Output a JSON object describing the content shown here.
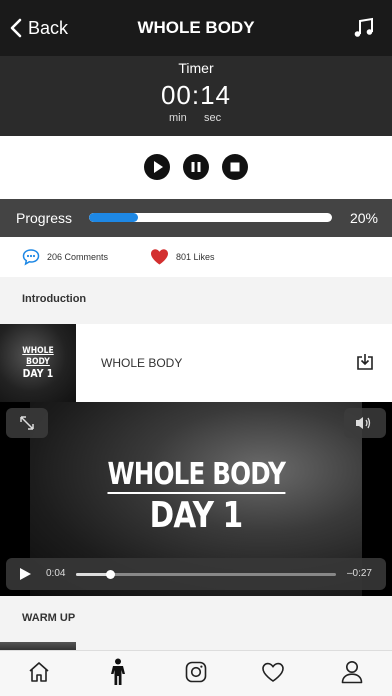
{
  "nav": {
    "back_label": "Back",
    "title": "WHOLE BODY",
    "music_icon": "music-note-icon"
  },
  "timer": {
    "label": "Timer",
    "value": "00:14",
    "min_label": "min",
    "sec_label": "sec"
  },
  "controls": {
    "play_icon": "play-icon",
    "pause_icon": "pause-icon",
    "stop_icon": "stop-icon"
  },
  "progress": {
    "label": "Progress",
    "percent_text": "20%",
    "fraction": 0.2,
    "color": "#1e88e5"
  },
  "social": {
    "comments": "206 Comments",
    "likes": "801 Likes",
    "comment_color": "#1e88e5",
    "like_color": "#d32f2f"
  },
  "sections": {
    "introduction": "Introduction",
    "warm_up": "WARM UP"
  },
  "intro_item": {
    "title": "WHOLE BODY",
    "thumb_line1": "WHOLE BODY",
    "thumb_line2": "DAY 1"
  },
  "video": {
    "title_line1": "WHOLE BODY",
    "title_line2": "DAY 1",
    "elapsed": "0:04",
    "remaining": "–0:27",
    "position_fraction": 0.13
  },
  "tabs": [
    {
      "name": "home",
      "icon": "home-icon"
    },
    {
      "name": "workouts",
      "icon": "person-icon"
    },
    {
      "name": "instagram",
      "icon": "instagram-icon"
    },
    {
      "name": "favorites",
      "icon": "heart-icon"
    },
    {
      "name": "profile",
      "icon": "user-icon"
    }
  ]
}
